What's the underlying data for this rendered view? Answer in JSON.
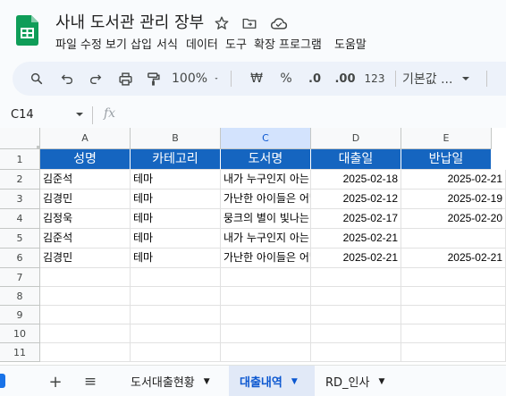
{
  "document": {
    "title": "사내 도서관 관리 장부"
  },
  "menu": [
    "파일",
    "수정",
    "보기",
    "삽입",
    "서식",
    "데이터",
    "도구",
    "확장 프로그램",
    "도움말"
  ],
  "toolbar": {
    "zoom": "100%",
    "currency": "₩",
    "percent": "%",
    "decrease_decimal": ".0",
    "increase_decimal": ".00",
    "number_format": "123",
    "font": "기본값 ..."
  },
  "formula_bar": {
    "name_box": "C14",
    "fx": "fx",
    "formula": ""
  },
  "columns": [
    "A",
    "B",
    "C",
    "D",
    "E"
  ],
  "rows": [
    "1",
    "2",
    "3",
    "4",
    "5",
    "6",
    "7",
    "8",
    "9",
    "10",
    "11"
  ],
  "table": {
    "headers": [
      "성명",
      "카테고리",
      "도서명",
      "대출일",
      "반납일"
    ],
    "rows": [
      [
        "김준석",
        "테마",
        "내가 누구인지 아는 것",
        "2025-02-18",
        "2025-02-21"
      ],
      [
        "김경민",
        "테마",
        "가난한 아이들은 어떻게",
        "2025-02-12",
        "2025-02-19"
      ],
      [
        "김정욱",
        "테마",
        "뭉크의 별이 빛나는 밤",
        "2025-02-17",
        "2025-02-20"
      ],
      [
        "김준석",
        "테마",
        "내가 누구인지 아는 것",
        "2025-02-21",
        ""
      ],
      [
        "김경민",
        "테마",
        "가난한 아이들은 어떻게",
        "2025-02-21",
        "2025-02-21"
      ]
    ]
  },
  "sheets": {
    "add": "+",
    "list": "≡",
    "tabs": [
      "도서대출현황",
      "대출내역",
      "RD_인사"
    ],
    "active": "대출내역"
  },
  "colors": {
    "header_fill": "#1565c0",
    "accent": "#0b57d0",
    "logo": "#0f9d58"
  }
}
